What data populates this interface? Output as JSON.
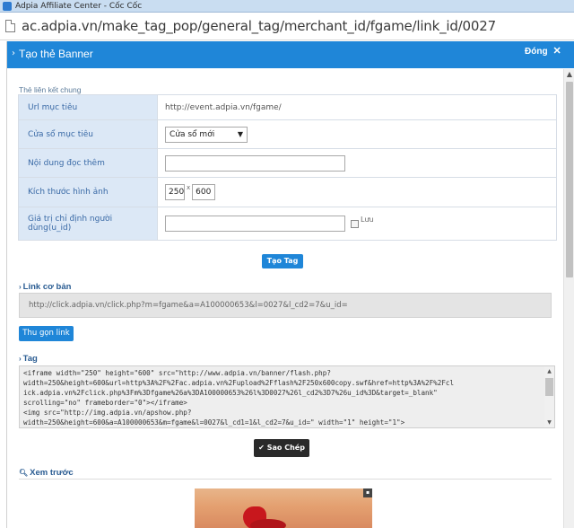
{
  "window": {
    "title": "Adpia Affiliate Center - Cốc Cốc"
  },
  "address_bar": {
    "url": "ac.adpia.vn/make_tag_pop/general_tag/merchant_id/fgame/link_id/0027"
  },
  "popup": {
    "title": "Tạo thẻ Banner",
    "close_label": "Đóng",
    "close_icon_glyph": "✕",
    "section_label": "Thẻ liên kết chung",
    "form": {
      "url_label": "Url mục tiêu",
      "url_value": "http://event.adpia.vn/fgame/",
      "window_label": "Cửa sổ mục tiêu",
      "window_selected": "Cửa sổ mới",
      "extra_content_label": "Nội dung đọc thêm",
      "extra_content_value": "",
      "image_size_label": "Kích thước hình ảnh",
      "width_value": "250",
      "size_separator": "x",
      "height_value": "600",
      "user_value_label": "Giá trị chỉ định người dùng(u_id)",
      "user_value": "",
      "save_label": "Lưu"
    },
    "create_button": "Tạo Tag",
    "basic_link": {
      "heading": "Link cơ bản",
      "value": "http://click.adpia.vn/click.php?m=fgame&a=A100000653&l=0027&l_cd2=7&u_id="
    },
    "shorten_button": "Thu gọn link",
    "tag": {
      "heading": "Tag",
      "lines": [
        "<iframe width=\"250\" height=\"600\" src=\"http://www.adpia.vn/banner/flash.php?",
        "width=250&height=600&url=http%3A%2F%2Fac.adpia.vn%2Fupload%2Fflash%2F250x600copy.swf&href=http%3A%2F%2Fcl",
        "ick.adpia.vn%2Fclick.php%3Fm%3Dfgame%26a%3DA100000653%26l%3D0027%26l_cd2%3D7%26u_id%3D&target=_blank\"",
        "scrolling=\"no\" frameborder=\"0\"></iframe>",
        "<img src=\"http://img.adpia.vn/apshow.php?",
        "width=250&height=600&a=A100000653&m=fgame&l=0027&l_cd1=1&l_cd2=7&u_id=\" width=\"1\" height=\"1\">"
      ]
    },
    "copy_button": "Sao Chép",
    "preview_heading": "Xem trước"
  },
  "colors": {
    "header_blue": "#1f86d8",
    "label_bg": "#dce8f6",
    "label_text": "#3a6aa6",
    "copy_button_bg": "#2a2a2a"
  }
}
